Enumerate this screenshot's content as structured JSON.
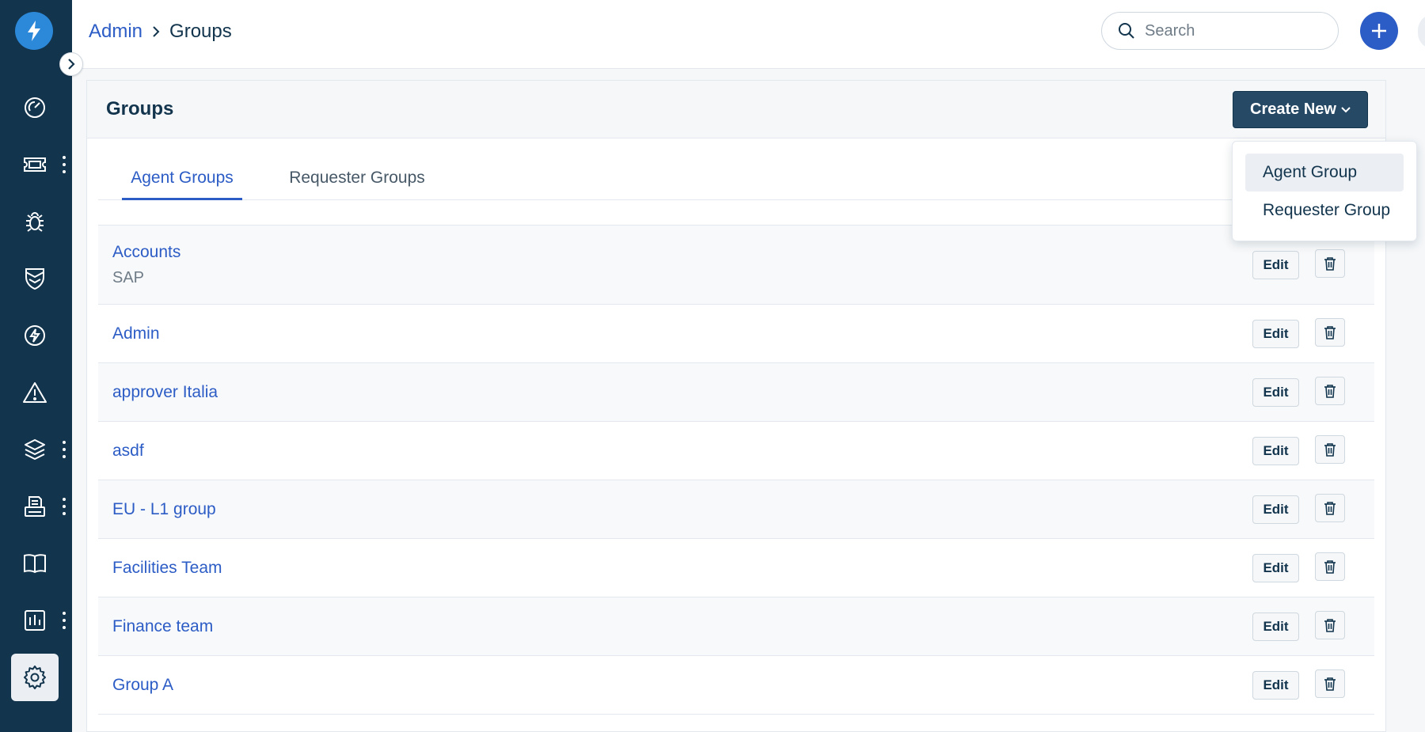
{
  "breadcrumb": {
    "parent": "Admin",
    "current": "Groups"
  },
  "search": {
    "placeholder": "Search",
    "value": ""
  },
  "panel": {
    "title": "Groups"
  },
  "create_button": {
    "label": "Create New"
  },
  "tabs": [
    {
      "label": "Agent Groups",
      "active": true
    },
    {
      "label": "Requester Groups",
      "active": false
    }
  ],
  "groups": [
    {
      "name": "Accounts",
      "subtitle": "SAP",
      "edit_label": "Edit"
    },
    {
      "name": "Admin",
      "edit_label": "Edit"
    },
    {
      "name": "approver Italia",
      "edit_label": "Edit"
    },
    {
      "name": "asdf",
      "edit_label": "Edit"
    },
    {
      "name": "EU - L1 group",
      "edit_label": "Edit"
    },
    {
      "name": "Facilities Team",
      "edit_label": "Edit"
    },
    {
      "name": "Finance team",
      "edit_label": "Edit"
    },
    {
      "name": "Group A",
      "edit_label": "Edit"
    }
  ],
  "dropdown": {
    "items": [
      {
        "label": "Agent Group"
      },
      {
        "label": "Requester Group"
      }
    ]
  },
  "sidebar": {
    "items": [
      {
        "icon": "dashboard-icon"
      },
      {
        "icon": "ticket-icon"
      },
      {
        "icon": "bug-icon"
      },
      {
        "icon": "shield-icon"
      },
      {
        "icon": "lightning-icon"
      },
      {
        "icon": "alert-icon"
      },
      {
        "icon": "layers-icon"
      },
      {
        "icon": "printer-icon"
      },
      {
        "icon": "book-icon"
      },
      {
        "icon": "reports-icon"
      },
      {
        "icon": "gear-icon"
      }
    ]
  },
  "colors": {
    "sidebar": "#12344d",
    "accent": "#2c5cc5",
    "create_button": "#264966",
    "logo": "#2c88d9"
  }
}
